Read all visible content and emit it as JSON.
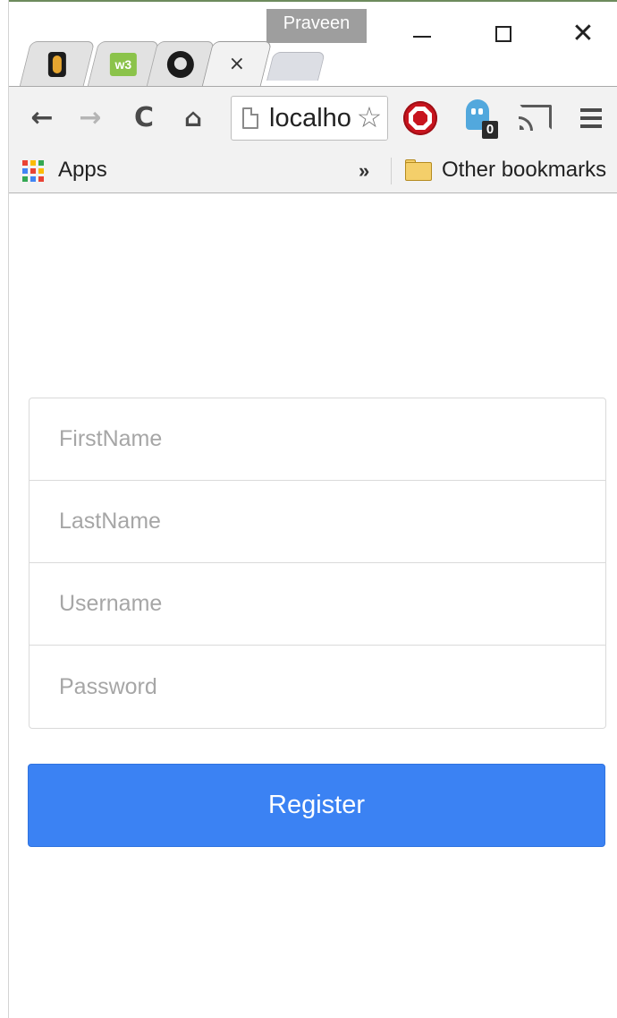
{
  "window": {
    "profile_name": "Praveen",
    "minimize_glyph": "—",
    "maximize_glyph": "□",
    "close_glyph": "✕"
  },
  "tabs": [
    {
      "icon": "tampermonkey-icon",
      "active": false
    },
    {
      "icon": "w3-icon",
      "label": "w3",
      "active": false
    },
    {
      "icon": "github-icon",
      "active": false
    },
    {
      "icon": "close-icon",
      "close_glyph": "×",
      "active": true
    }
  ],
  "toolbar": {
    "back_glyph": "←",
    "forward_glyph": "→",
    "reload_glyph": "C",
    "home_glyph": "⌂",
    "address_text": "localhost:",
    "star_glyph": "☆",
    "extension_badge_count": "0"
  },
  "bookmarks": {
    "apps_label": "Apps",
    "overflow_glyph": "»",
    "other_bookmarks_label": "Other bookmarks",
    "apps_grid_colors": [
      "#e94335",
      "#fbbc05",
      "#34a853",
      "#4285f4",
      "#e94335",
      "#fbbc05",
      "#34a853",
      "#4285f4",
      "#e94335"
    ]
  },
  "form": {
    "firstname_placeholder": "FirstName",
    "lastname_placeholder": "LastName",
    "username_placeholder": "Username",
    "password_placeholder": "Password",
    "register_label": "Register"
  },
  "colors": {
    "accent": "#3b82f3",
    "adblock_red": "#c8141e",
    "ghostery_blue": "#52a8dd"
  }
}
